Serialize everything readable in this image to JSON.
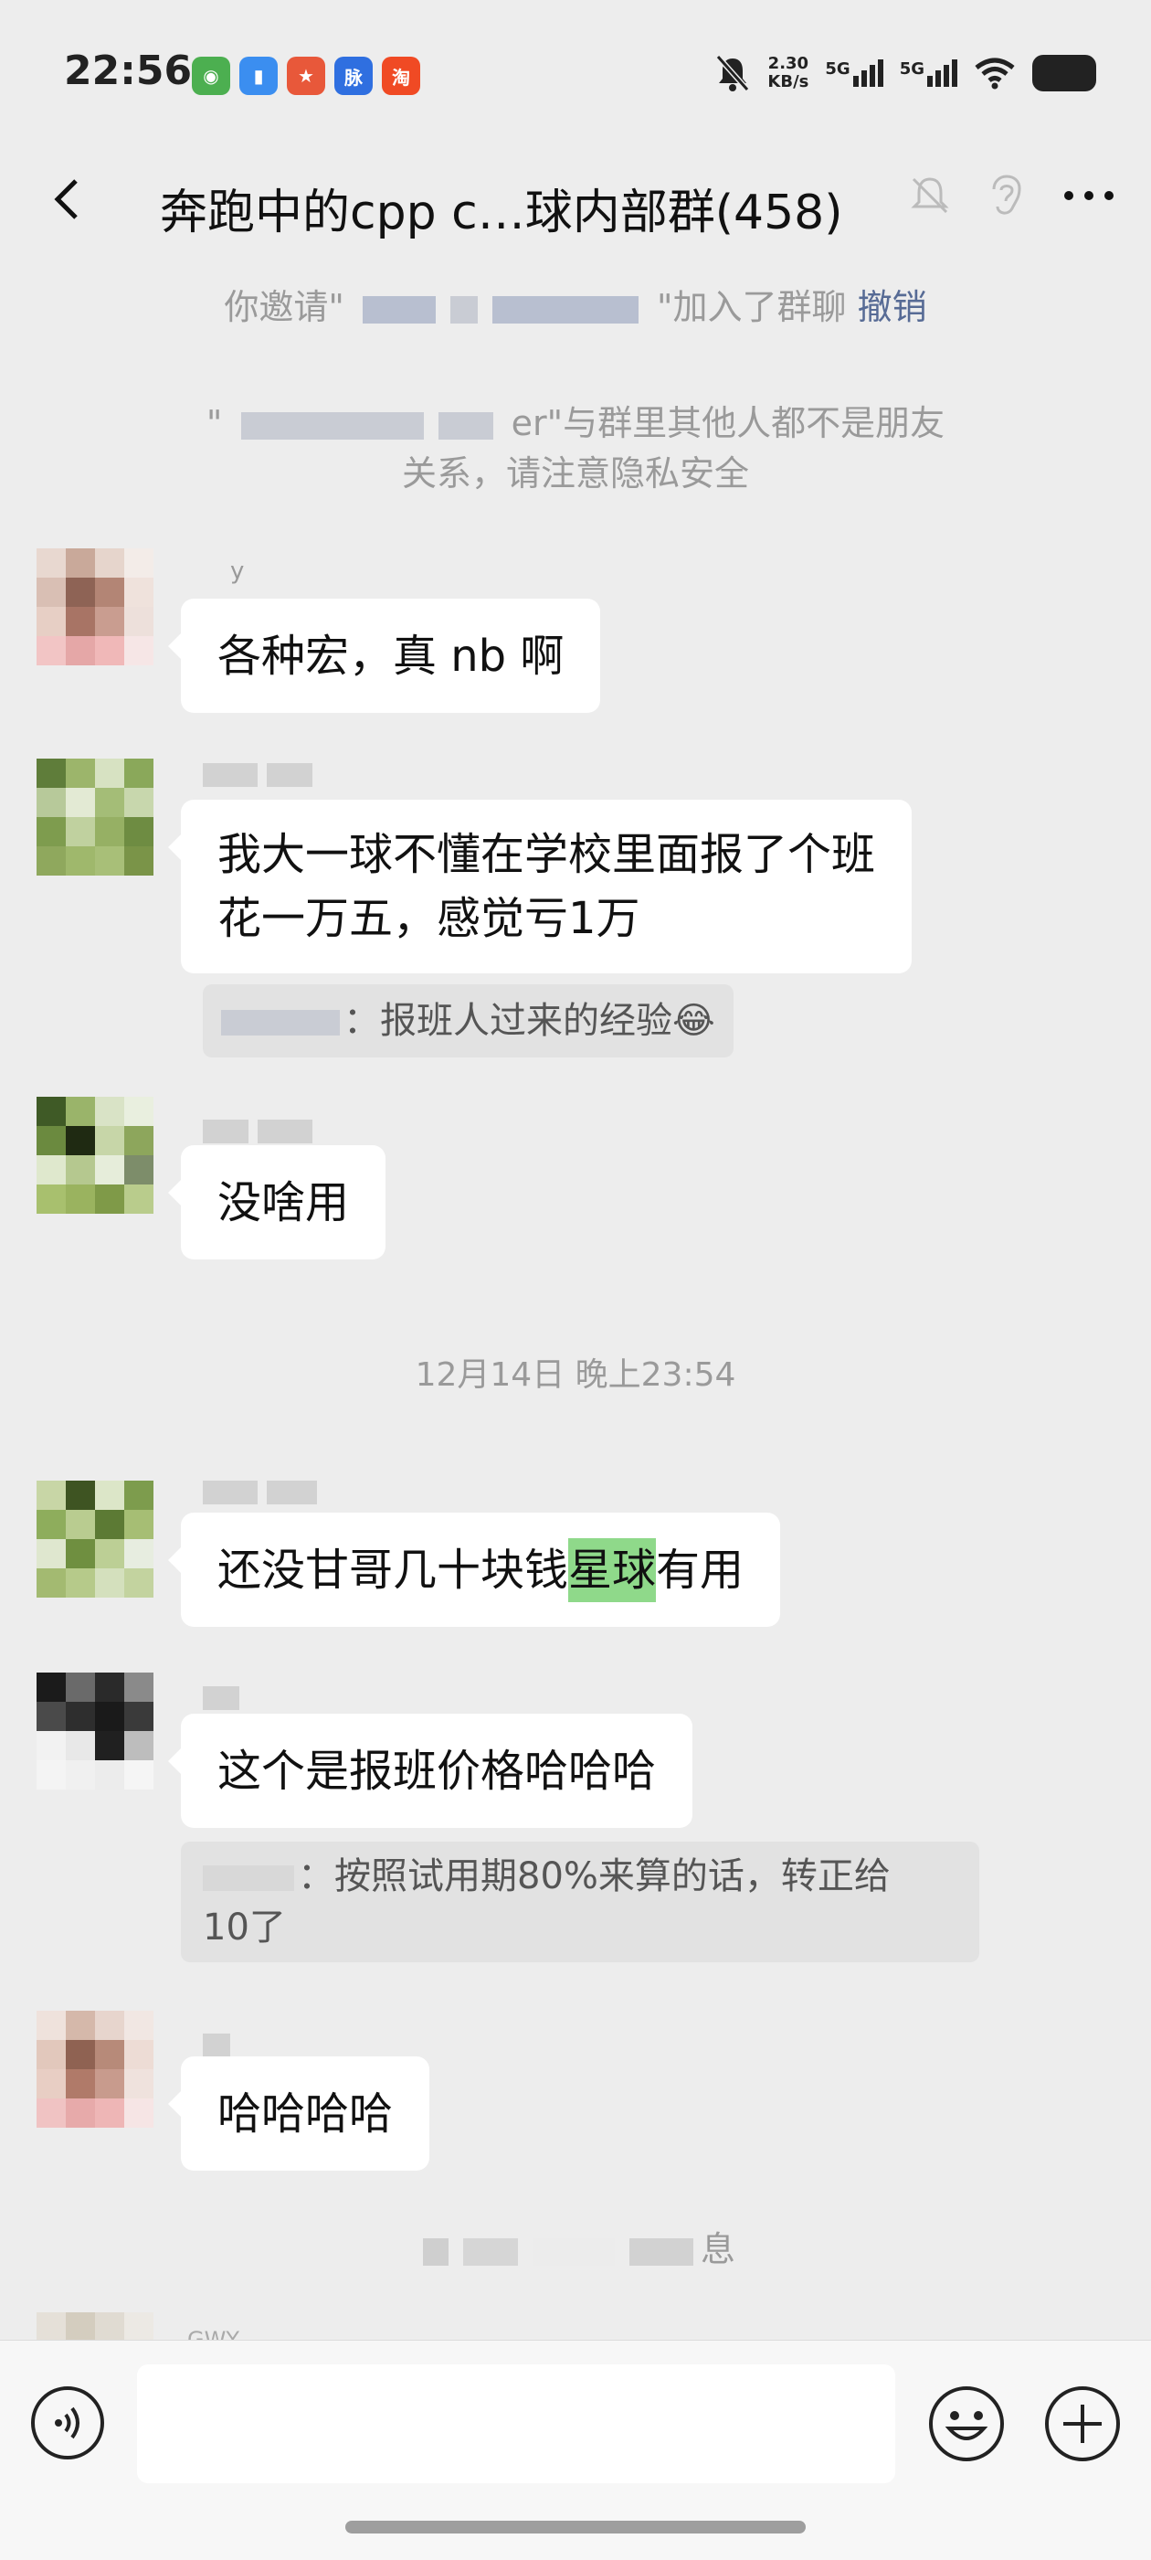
{
  "status_bar": {
    "time": "22:56",
    "speed_value": "2.30",
    "speed_unit": "KB/s",
    "sig1": "5G",
    "sig2": "5G",
    "app_icons": [
      "gallery-app-icon",
      "files-app-icon",
      "game-app-icon",
      "maimai-app-icon",
      "taobao-app-icon"
    ],
    "maimai_label": "脉"
  },
  "header": {
    "title": "奔跑中的cpp c…球内部群(458)",
    "icons": [
      "back-icon",
      "mute-icon",
      "ear-icon",
      "more-icon"
    ]
  },
  "system_messages": {
    "invite_prefix": "你邀请\"",
    "invite_suffix": "\"加入了群聊",
    "undo_label": "撤销",
    "privacy_prefix": "\"",
    "privacy_line1": "er\"与群里其他人都不是朋友",
    "privacy_line2": "关系，请注意隐私安全",
    "bottom_notice": "息"
  },
  "messages": [
    {
      "text": "各种宏，真 nb 啊",
      "nick": "y"
    },
    {
      "line1": "我大一球不懂在学校里面报了个班",
      "line2": "花一万五，感觉亏1万",
      "quote": "：报班人过来的经验"
    },
    {
      "text": "没啥用"
    },
    {
      "before": "还没甘哥几十块钱",
      "highlight": "星球",
      "after": "有用"
    },
    {
      "text": "这个是报班价格哈哈哈",
      "quote_line1": "：按照试用期80%来算的话，转正给",
      "quote_line2": "10了"
    },
    {
      "text": "哈哈哈哈"
    }
  ],
  "timestamp": "12月14日 晚上23:54",
  "partial_nick": "GWY",
  "colors": {
    "background": "#ededed",
    "bubble": "#ffffff",
    "link": "#576b95",
    "highlight": "#8fd98a"
  }
}
